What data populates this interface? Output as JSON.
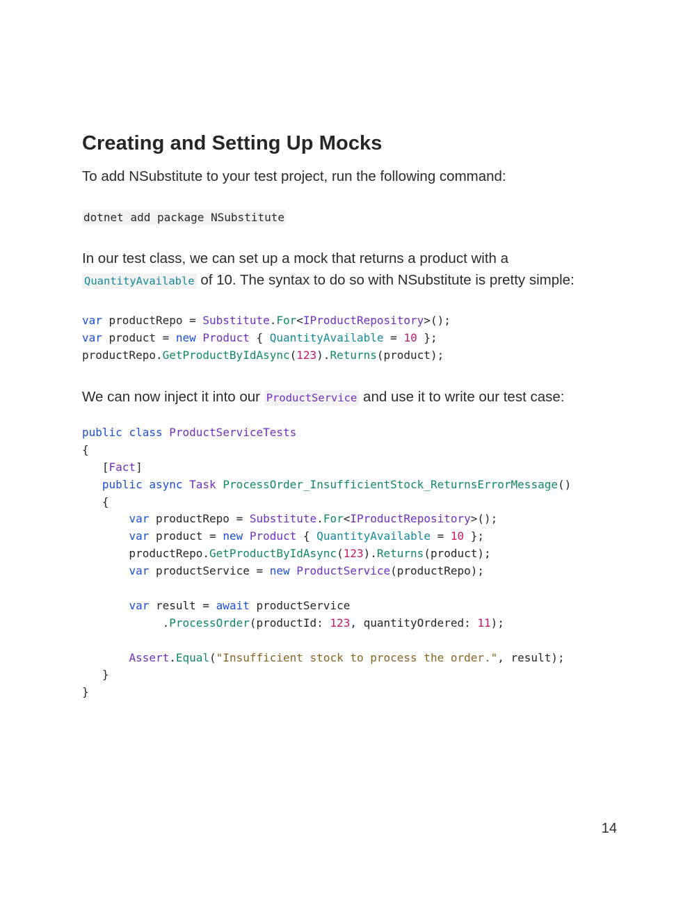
{
  "heading": "Creating and Setting Up Mocks",
  "intro": "To add NSubstitute to your test project, run the following command:",
  "command": "dotnet add package NSubstitute",
  "para2": {
    "part1": "In our test class, we can set up a mock that returns a product with a",
    "code": "QuantityAvailable",
    "part2": " of 10. The syntax to do so with NSubstitute is pretty simple:"
  },
  "para3": {
    "part1": "We can now inject it into our ",
    "code": "ProductService",
    "part2": " and use it to write our test case:"
  },
  "snippet1": [
    [
      [
        "kw",
        "var"
      ],
      [
        "pl",
        " productRepo = "
      ],
      [
        "ty",
        "Substitute"
      ],
      [
        "pl",
        "."
      ],
      [
        "fn",
        "For"
      ],
      [
        "pl",
        "<"
      ],
      [
        "ty",
        "IProductRepository"
      ],
      [
        "pl",
        ">();"
      ]
    ],
    [
      [
        "kw",
        "var"
      ],
      [
        "pl",
        " product = "
      ],
      [
        "kw",
        "new"
      ],
      [
        "pl",
        " "
      ],
      [
        "ty",
        "Product"
      ],
      [
        "pl",
        " { "
      ],
      [
        "pr",
        "QuantityAvailable"
      ],
      [
        "pl",
        " = "
      ],
      [
        "nm",
        "10"
      ],
      [
        "pl",
        " };"
      ]
    ],
    [
      [
        "pl",
        "productRepo."
      ],
      [
        "fn",
        "GetProductByIdAsync"
      ],
      [
        "pl",
        "("
      ],
      [
        "nm",
        "123"
      ],
      [
        "pl",
        ")."
      ],
      [
        "fn",
        "Returns"
      ],
      [
        "pl",
        "(product);"
      ]
    ]
  ],
  "snippet2": [
    [
      [
        "kw",
        "public"
      ],
      [
        "pl",
        " "
      ],
      [
        "kw",
        "class"
      ],
      [
        "pl",
        " "
      ],
      [
        "ty",
        "ProductServiceTests"
      ]
    ],
    [
      [
        "pl",
        "{"
      ]
    ],
    [
      [
        "pl",
        "   ["
      ],
      [
        "ty",
        "Fact"
      ],
      [
        "pl",
        "]"
      ]
    ],
    [
      [
        "pl",
        "   "
      ],
      [
        "kw",
        "public"
      ],
      [
        "pl",
        " "
      ],
      [
        "kw",
        "async"
      ],
      [
        "pl",
        " "
      ],
      [
        "ty",
        "Task"
      ],
      [
        "pl",
        " "
      ],
      [
        "fn",
        "ProcessOrder_InsufficientStock_ReturnsErrorMessage"
      ],
      [
        "pl",
        "()"
      ]
    ],
    [
      [
        "pl",
        "   {"
      ]
    ],
    [
      [
        "pl",
        "       "
      ],
      [
        "kw",
        "var"
      ],
      [
        "pl",
        " productRepo = "
      ],
      [
        "ty",
        "Substitute"
      ],
      [
        "pl",
        "."
      ],
      [
        "fn",
        "For"
      ],
      [
        "pl",
        "<"
      ],
      [
        "ty",
        "IProductRepository"
      ],
      [
        "pl",
        ">();"
      ]
    ],
    [
      [
        "pl",
        "       "
      ],
      [
        "kw",
        "var"
      ],
      [
        "pl",
        " product = "
      ],
      [
        "kw",
        "new"
      ],
      [
        "pl",
        " "
      ],
      [
        "ty",
        "Product"
      ],
      [
        "pl",
        " { "
      ],
      [
        "pr",
        "QuantityAvailable"
      ],
      [
        "pl",
        " = "
      ],
      [
        "nm",
        "10"
      ],
      [
        "pl",
        " };"
      ]
    ],
    [
      [
        "pl",
        "       productRepo."
      ],
      [
        "fn",
        "GetProductByIdAsync"
      ],
      [
        "pl",
        "("
      ],
      [
        "nm",
        "123"
      ],
      [
        "pl",
        ")."
      ],
      [
        "fn",
        "Returns"
      ],
      [
        "pl",
        "(product);"
      ]
    ],
    [
      [
        "pl",
        "       "
      ],
      [
        "kw",
        "var"
      ],
      [
        "pl",
        " productService = "
      ],
      [
        "kw",
        "new"
      ],
      [
        "pl",
        " "
      ],
      [
        "ty",
        "ProductService"
      ],
      [
        "pl",
        "(productRepo);"
      ]
    ],
    [
      [
        "pl",
        ""
      ]
    ],
    [
      [
        "pl",
        "       "
      ],
      [
        "kw",
        "var"
      ],
      [
        "pl",
        " result = "
      ],
      [
        "kw",
        "await"
      ],
      [
        "pl",
        " productService"
      ]
    ],
    [
      [
        "pl",
        "            ."
      ],
      [
        "fn",
        "ProcessOrder"
      ],
      [
        "pl",
        "(productId: "
      ],
      [
        "nm",
        "123"
      ],
      [
        "pl",
        ", quantityOrdered: "
      ],
      [
        "nm",
        "11"
      ],
      [
        "pl",
        ");"
      ]
    ],
    [
      [
        "pl",
        ""
      ]
    ],
    [
      [
        "pl",
        "       "
      ],
      [
        "ty",
        "Assert"
      ],
      [
        "pl",
        "."
      ],
      [
        "fn",
        "Equal"
      ],
      [
        "pl",
        "("
      ],
      [
        "st",
        "\"Insufficient stock to process the order.\""
      ],
      [
        "pl",
        ", result);"
      ]
    ],
    [
      [
        "pl",
        "   }"
      ]
    ],
    [
      [
        "pl",
        "}"
      ]
    ]
  ],
  "page_number": "14"
}
